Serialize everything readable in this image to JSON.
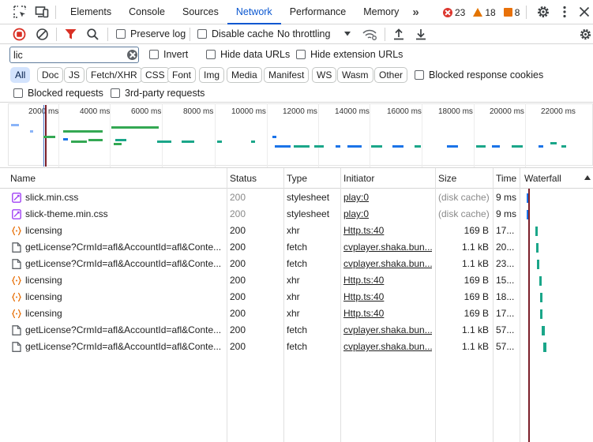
{
  "tabs": [
    {
      "label": "Elements"
    },
    {
      "label": "Console"
    },
    {
      "label": "Sources"
    },
    {
      "label": "Network"
    },
    {
      "label": "Performance"
    },
    {
      "label": "Memory"
    }
  ],
  "more_tabs_label": "»",
  "issue_counts": {
    "errors": "23",
    "warnings": "18",
    "info": "8"
  },
  "toolbar": {
    "preserve_log": "Preserve log",
    "disable_cache": "Disable cache",
    "throttling": "No throttling"
  },
  "filter": {
    "value": "lic",
    "invert": "Invert",
    "hide_data_urls": "Hide data URLs",
    "hide_extension_urls": "Hide extension URLs"
  },
  "type_filters": [
    "All",
    "Doc",
    "JS",
    "Fetch/XHR",
    "CSS",
    "Font",
    "Img",
    "Media",
    "Manifest",
    "WS",
    "Wasm",
    "Other"
  ],
  "active_type_filter": "All",
  "blocked_response_cookies": "Blocked response cookies",
  "blocked_requests": "Blocked requests",
  "third_party_requests": "3rd-party requests",
  "overview": {
    "tick_labels": [
      "2000 ms",
      "4000 ms",
      "6000 ms",
      "8000 ms",
      "10000 ms",
      "12000 ms",
      "14000 ms",
      "16000 ms",
      "18000 ms",
      "20000 ms",
      "22000 ms"
    ]
  },
  "columns": [
    "Name",
    "Status",
    "Type",
    "Initiator",
    "Size",
    "Time",
    "Waterfall"
  ],
  "requests": [
    {
      "name": "slick.min.css",
      "status": "200",
      "type": "stylesheet",
      "initiator": "play:0",
      "size": "(disk cache)",
      "time": "9 ms",
      "kind": "css",
      "muted": true
    },
    {
      "name": "slick-theme.min.css",
      "status": "200",
      "type": "stylesheet",
      "initiator": "play:0",
      "size": "(disk cache)",
      "time": "9 ms",
      "kind": "css",
      "muted": true
    },
    {
      "name": "licensing",
      "status": "200",
      "type": "xhr",
      "initiator": "Http.ts:40",
      "size": "169 B",
      "time": "17...",
      "kind": "xhr",
      "muted": false
    },
    {
      "name": "getLicense?CrmId=afl&AccountId=afl&Conte...",
      "status": "200",
      "type": "fetch",
      "initiator": "cvplayer.shaka.bun...",
      "size": "1.1 kB",
      "time": "20...",
      "kind": "doc",
      "muted": false
    },
    {
      "name": "getLicense?CrmId=afl&AccountId=afl&Conte...",
      "status": "200",
      "type": "fetch",
      "initiator": "cvplayer.shaka.bun...",
      "size": "1.1 kB",
      "time": "23...",
      "kind": "doc",
      "muted": false
    },
    {
      "name": "licensing",
      "status": "200",
      "type": "xhr",
      "initiator": "Http.ts:40",
      "size": "169 B",
      "time": "15...",
      "kind": "xhr",
      "muted": false
    },
    {
      "name": "licensing",
      "status": "200",
      "type": "xhr",
      "initiator": "Http.ts:40",
      "size": "169 B",
      "time": "18...",
      "kind": "xhr",
      "muted": false
    },
    {
      "name": "licensing",
      "status": "200",
      "type": "xhr",
      "initiator": "Http.ts:40",
      "size": "169 B",
      "time": "17...",
      "kind": "xhr",
      "muted": false
    },
    {
      "name": "getLicense?CrmId=afl&AccountId=afl&Conte...",
      "status": "200",
      "type": "fetch",
      "initiator": "cvplayer.shaka.bun...",
      "size": "1.1 kB",
      "time": "57...",
      "kind": "doc",
      "muted": false
    },
    {
      "name": "getLicense?CrmId=afl&AccountId=afl&Conte...",
      "status": "200",
      "type": "fetch",
      "initiator": "cvplayer.shaka.bun...",
      "size": "1.1 kB",
      "time": "57...",
      "kind": "doc",
      "muted": false
    }
  ],
  "colors": {
    "accent": "#0b57d0",
    "error": "#dc362e",
    "warning": "#e37400",
    "css_icon": "#a142f4",
    "xhr_icon": "#e8710a",
    "waterfall_teal": "#1aa689",
    "waterfall_blue": "#1a73e8"
  }
}
